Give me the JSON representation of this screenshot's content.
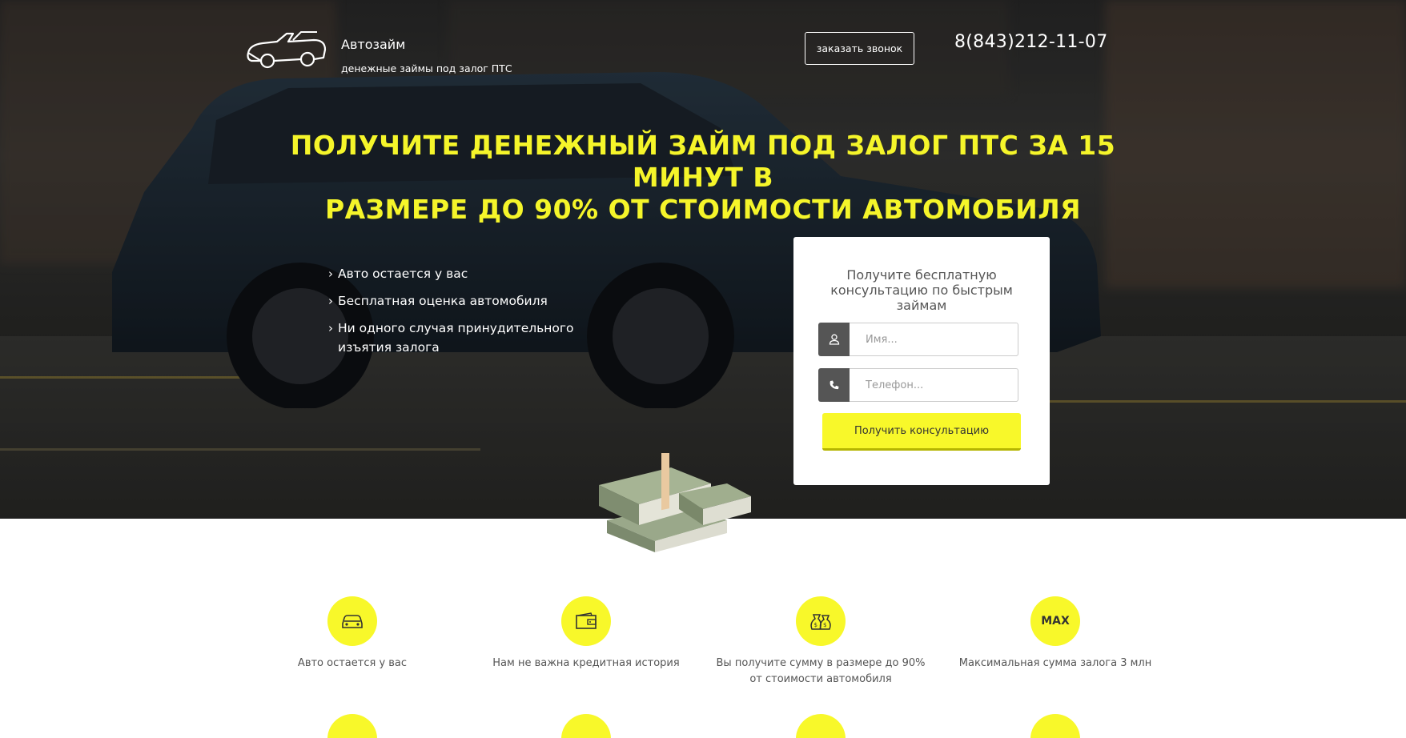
{
  "header": {
    "brand_name": "Автозайм",
    "brand_sub": "денежные займы под залог ПТС",
    "call_button": "заказать звонок",
    "phone": "8(843)212-11-07"
  },
  "hero": {
    "headline_line1": "Получите денежный займ под залог ПТС за 15 минут в",
    "headline_line2": "размере до 90% от стоимости автомобиля",
    "benefits": [
      "Авто остается у вас",
      "Бесплатная оценка автомобиля",
      "Ни одного случая принудительного изъятия залога"
    ]
  },
  "form": {
    "title": "Получите бесплатную консультацию по быстрым займам",
    "name_placeholder": "Имя...",
    "phone_placeholder": "Телефон...",
    "submit_label": "Получить консультацию"
  },
  "features": [
    {
      "icon": "car-icon",
      "text": "Авто остается у вас"
    },
    {
      "icon": "wallet-icon",
      "text": "Нам не важна кредитная история"
    },
    {
      "icon": "money-bags-icon",
      "text": "Вы получите сумму в размере до 90% от стоимости автомобиля"
    },
    {
      "icon": "max-icon",
      "label": "MAX",
      "text": "Максимальная сумма залога 3 млн"
    }
  ],
  "colors": {
    "accent": "#f8f82a",
    "headline": "#f5f52a",
    "text_gray": "#555555",
    "input_addon": "#555555"
  }
}
